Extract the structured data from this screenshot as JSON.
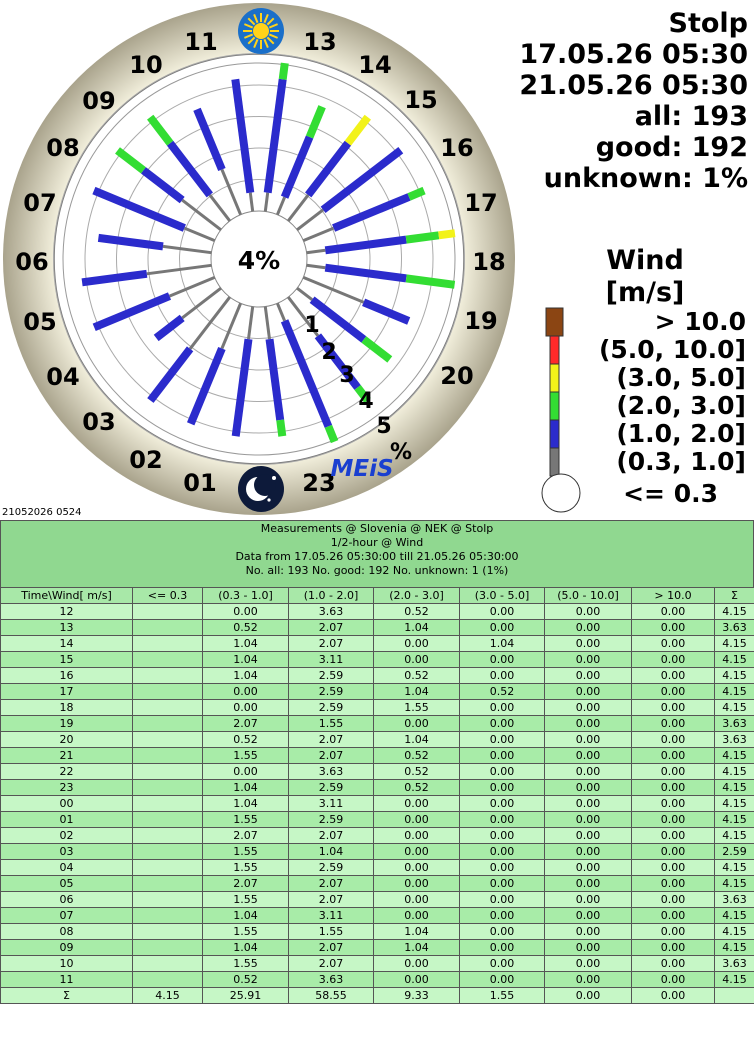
{
  "station": {
    "name": "Stolp",
    "date_from": "17.05.26 05:30",
    "date_to": "21.05.26 05:30",
    "all_label": "all: 193",
    "good_label": "good: 192",
    "unknown_label": "unknown: 1%"
  },
  "center_label": "4%",
  "logo_text": "MEiS",
  "footer_stamp": "21052026 0524",
  "legend": {
    "title_line1": "Wind",
    "title_line2": "[m/s]",
    "labels": [
      "> 10.0",
      "(5.0, 10.0]",
      "(3.0, 5.0]",
      "(2.0, 3.0]",
      "(1.0, 2.0]",
      "(0.3, 1.0]",
      "<= 0.3"
    ],
    "colors": [
      "#8b4513",
      "#ff2a2a",
      "#f2f21a",
      "#33dd33",
      "#2b2bcc",
      "#777777",
      "#ffffff"
    ]
  },
  "chart_data": {
    "type": "polar-stacked-bar",
    "hours": [
      "12",
      "13",
      "14",
      "15",
      "16",
      "17",
      "18",
      "19",
      "20",
      "21",
      "22",
      "23",
      "00",
      "01",
      "02",
      "03",
      "04",
      "05",
      "06",
      "07",
      "08",
      "09",
      "10",
      "11"
    ],
    "hour_labels": [
      "11",
      "13",
      "14",
      "15",
      "16",
      "17",
      "18",
      "19",
      "20",
      "23",
      "01",
      "02",
      "03",
      "04",
      "05",
      "06",
      "07",
      "08",
      "09",
      "10"
    ],
    "ring_labels": [
      "1",
      "2",
      "3",
      "4",
      "5"
    ],
    "ring_unit": "%",
    "series": [
      {
        "name": "(0.3 - 1.0]",
        "values": [
          0.0,
          0.52,
          1.04,
          1.04,
          1.04,
          0.0,
          0.0,
          2.07,
          0.52,
          1.55,
          0.0,
          1.04,
          1.04,
          1.55,
          2.07,
          1.55,
          1.55,
          2.07,
          1.55,
          1.04,
          1.55,
          1.04,
          1.55,
          0.52
        ]
      },
      {
        "name": "(1.0 - 2.0]",
        "values": [
          3.63,
          2.07,
          2.07,
          3.11,
          2.59,
          2.59,
          2.59,
          1.55,
          2.07,
          2.07,
          3.63,
          2.59,
          3.11,
          2.59,
          2.07,
          1.04,
          2.59,
          2.07,
          2.07,
          3.11,
          1.55,
          2.07,
          2.07,
          3.63
        ]
      },
      {
        "name": "(2.0 - 3.0]",
        "values": [
          0.52,
          1.04,
          0.0,
          0.0,
          0.52,
          1.04,
          1.55,
          0.0,
          1.04,
          0.52,
          0.52,
          0.52,
          0.0,
          0.0,
          0.0,
          0.0,
          0.0,
          0.0,
          0.0,
          0.0,
          1.04,
          1.04,
          0.0,
          0.0
        ]
      },
      {
        "name": "(3.0 - 5.0]",
        "values": [
          0.0,
          0.0,
          1.04,
          0.0,
          0.0,
          0.52,
          0.0,
          0.0,
          0.0,
          0.0,
          0.0,
          0.0,
          0.0,
          0.0,
          0.0,
          0.0,
          0.0,
          0.0,
          0.0,
          0.0,
          0.0,
          0.0,
          0.0,
          0.0
        ]
      },
      {
        "name": "(5.0 - 10.0]",
        "values": [
          0.0,
          0.0,
          0.0,
          0.0,
          0.0,
          0.0,
          0.0,
          0.0,
          0.0,
          0.0,
          0.0,
          0.0,
          0.0,
          0.0,
          0.0,
          0.0,
          0.0,
          0.0,
          0.0,
          0.0,
          0.0,
          0.0,
          0.0,
          0.0
        ]
      },
      {
        "name": "> 10.0",
        "values": [
          0.0,
          0.0,
          0.0,
          0.0,
          0.0,
          0.0,
          0.0,
          0.0,
          0.0,
          0.0,
          0.0,
          0.0,
          0.0,
          0.0,
          0.0,
          0.0,
          0.0,
          0.0,
          0.0,
          0.0,
          0.0,
          0.0,
          0.0,
          0.0
        ]
      }
    ],
    "calm_percent": 4.15
  },
  "table": {
    "title_lines": [
      "Measurements @ Slovenia @ NEK @ Stolp",
      "1/2-hour @ Wind",
      "Data from 17.05.26 05:30:00 till 21.05.26 05:30:00",
      "No. all: 193   No. good: 192   No. unknown: 1 (1%)"
    ],
    "headers": [
      "Time\\Wind[ m/s]",
      "<= 0.3",
      "(0.3 - 1.0]",
      "(1.0 - 2.0]",
      "(2.0 - 3.0]",
      "(3.0 - 5.0]",
      "(5.0 - 10.0]",
      "> 10.0",
      "Σ"
    ],
    "rows": [
      [
        "12",
        "",
        "0.00",
        "3.63",
        "0.52",
        "0.00",
        "0.00",
        "0.00",
        "4.15"
      ],
      [
        "13",
        "",
        "0.52",
        "2.07",
        "1.04",
        "0.00",
        "0.00",
        "0.00",
        "3.63"
      ],
      [
        "14",
        "",
        "1.04",
        "2.07",
        "0.00",
        "1.04",
        "0.00",
        "0.00",
        "4.15"
      ],
      [
        "15",
        "",
        "1.04",
        "3.11",
        "0.00",
        "0.00",
        "0.00",
        "0.00",
        "4.15"
      ],
      [
        "16",
        "",
        "1.04",
        "2.59",
        "0.52",
        "0.00",
        "0.00",
        "0.00",
        "4.15"
      ],
      [
        "17",
        "",
        "0.00",
        "2.59",
        "1.04",
        "0.52",
        "0.00",
        "0.00",
        "4.15"
      ],
      [
        "18",
        "",
        "0.00",
        "2.59",
        "1.55",
        "0.00",
        "0.00",
        "0.00",
        "4.15"
      ],
      [
        "19",
        "",
        "2.07",
        "1.55",
        "0.00",
        "0.00",
        "0.00",
        "0.00",
        "3.63"
      ],
      [
        "20",
        "",
        "0.52",
        "2.07",
        "1.04",
        "0.00",
        "0.00",
        "0.00",
        "3.63"
      ],
      [
        "21",
        "",
        "1.55",
        "2.07",
        "0.52",
        "0.00",
        "0.00",
        "0.00",
        "4.15"
      ],
      [
        "22",
        "",
        "0.00",
        "3.63",
        "0.52",
        "0.00",
        "0.00",
        "0.00",
        "4.15"
      ],
      [
        "23",
        "",
        "1.04",
        "2.59",
        "0.52",
        "0.00",
        "0.00",
        "0.00",
        "4.15"
      ],
      [
        "00",
        "",
        "1.04",
        "3.11",
        "0.00",
        "0.00",
        "0.00",
        "0.00",
        "4.15"
      ],
      [
        "01",
        "",
        "1.55",
        "2.59",
        "0.00",
        "0.00",
        "0.00",
        "0.00",
        "4.15"
      ],
      [
        "02",
        "",
        "2.07",
        "2.07",
        "0.00",
        "0.00",
        "0.00",
        "0.00",
        "4.15"
      ],
      [
        "03",
        "",
        "1.55",
        "1.04",
        "0.00",
        "0.00",
        "0.00",
        "0.00",
        "2.59"
      ],
      [
        "04",
        "",
        "1.55",
        "2.59",
        "0.00",
        "0.00",
        "0.00",
        "0.00",
        "4.15"
      ],
      [
        "05",
        "",
        "2.07",
        "2.07",
        "0.00",
        "0.00",
        "0.00",
        "0.00",
        "4.15"
      ],
      [
        "06",
        "",
        "1.55",
        "2.07",
        "0.00",
        "0.00",
        "0.00",
        "0.00",
        "3.63"
      ],
      [
        "07",
        "",
        "1.04",
        "3.11",
        "0.00",
        "0.00",
        "0.00",
        "0.00",
        "4.15"
      ],
      [
        "08",
        "",
        "1.55",
        "1.55",
        "1.04",
        "0.00",
        "0.00",
        "0.00",
        "4.15"
      ],
      [
        "09",
        "",
        "1.04",
        "2.07",
        "1.04",
        "0.00",
        "0.00",
        "0.00",
        "4.15"
      ],
      [
        "10",
        "",
        "1.55",
        "2.07",
        "0.00",
        "0.00",
        "0.00",
        "0.00",
        "3.63"
      ],
      [
        "11",
        "",
        "0.52",
        "3.63",
        "0.00",
        "0.00",
        "0.00",
        "0.00",
        "4.15"
      ],
      [
        "Σ",
        "4.15",
        "25.91",
        "58.55",
        "9.33",
        "1.55",
        "0.00",
        "0.00",
        ""
      ]
    ]
  }
}
